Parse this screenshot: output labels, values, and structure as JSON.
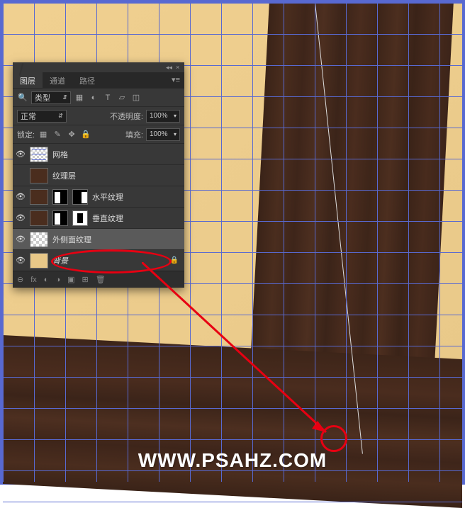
{
  "panel": {
    "tabs": {
      "layers": "图层",
      "channels": "通道",
      "paths": "路径"
    },
    "filter_label": "类型",
    "blend_mode": "正常",
    "opacity_label": "不透明度:",
    "opacity_value": "100%",
    "lock_label": "锁定:",
    "fill_label": "填充:",
    "fill_value": "100%"
  },
  "layers": [
    {
      "name": "网格",
      "visible": true
    },
    {
      "name": "纹理层",
      "visible": false
    },
    {
      "name": "水平纹理",
      "visible": true
    },
    {
      "name": "垂直纹理",
      "visible": true
    },
    {
      "name": "外侧面纹理",
      "visible": true,
      "selected": true
    },
    {
      "name": "背景",
      "visible": true,
      "locked": true,
      "italic": true
    }
  ],
  "bottom_icons": [
    "⊖",
    "fx",
    "◐",
    "◑",
    "▣",
    "⊞",
    "🗑"
  ],
  "watermark": "WWW.PSAHZ.COM"
}
